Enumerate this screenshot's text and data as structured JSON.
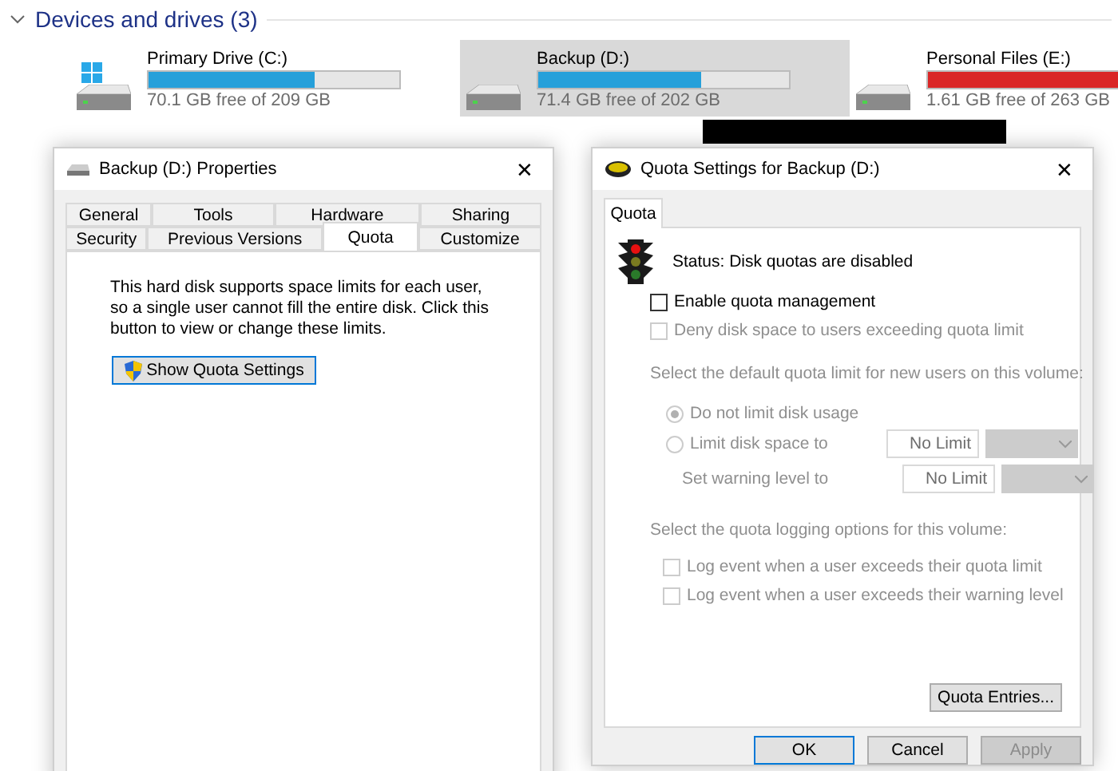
{
  "section": {
    "title": "Devices and drives (3)",
    "expanded": true
  },
  "drives": [
    {
      "name": "Primary Drive (C:)",
      "free": "70.1 GB free of 209 GB",
      "level": 0.66,
      "selected": false,
      "system": true,
      "color": "#26a0da"
    },
    {
      "name": "Backup (D:)",
      "free": "71.4 GB free of 202 GB",
      "level": 0.65,
      "selected": true,
      "system": false,
      "color": "#26a0da"
    },
    {
      "name": "Personal Files (E:)",
      "free": "1.61 GB free of 263 GB",
      "level": 0.99,
      "selected": false,
      "system": false,
      "color": "#da2626"
    }
  ],
  "properties": {
    "title": "Backup (D:) Properties",
    "close": "✕",
    "tab_rows": [
      [
        {
          "label": "General",
          "selected": false
        },
        {
          "label": "Tools",
          "selected": false
        },
        {
          "label": "Hardware",
          "selected": false
        },
        {
          "label": "Sharing",
          "selected": false
        }
      ],
      [
        {
          "label": "Security",
          "selected": false
        },
        {
          "label": "Previous Versions",
          "selected": false
        },
        {
          "label": "Quota",
          "selected": true
        },
        {
          "label": "Customize",
          "selected": false
        }
      ]
    ],
    "description": "This hard disk supports space limits for each user, so a single user cannot fill the entire disk. Click this button to view or change these limits.",
    "button": "Show Quota Settings"
  },
  "quota": {
    "title": "Quota Settings for Backup (D:)",
    "close": "✕",
    "tab": {
      "label": "Quota",
      "selected": true
    },
    "status": "Status:  Disk quotas are disabled",
    "enable": {
      "label": "Enable quota management",
      "checked": false,
      "disabled": false
    },
    "deny": {
      "label": "Deny disk space to users exceeding quota limit",
      "checked": false,
      "disabled": true
    },
    "limit_heading": "Select the default quota limit for new users on this volume:",
    "radios": [
      {
        "label": "Do not limit disk usage",
        "selected": true
      },
      {
        "label": "Limit disk space to",
        "selected": false
      }
    ],
    "limit_value": "No Limit",
    "warning_label": "Set warning level to",
    "warning_value": "No Limit",
    "logging_heading": "Select the quota logging options for this volume:",
    "logging": [
      {
        "label": "Log event when a user exceeds their quota limit",
        "checked": false
      },
      {
        "label": "Log event when a user exceeds their warning level",
        "checked": false
      }
    ],
    "entries_button": "Quota Entries...",
    "buttons": [
      {
        "label": "OK",
        "default": true,
        "disabled": false
      },
      {
        "label": "Cancel",
        "default": false,
        "disabled": false
      },
      {
        "label": "Apply",
        "default": false,
        "disabled": true
      }
    ]
  }
}
